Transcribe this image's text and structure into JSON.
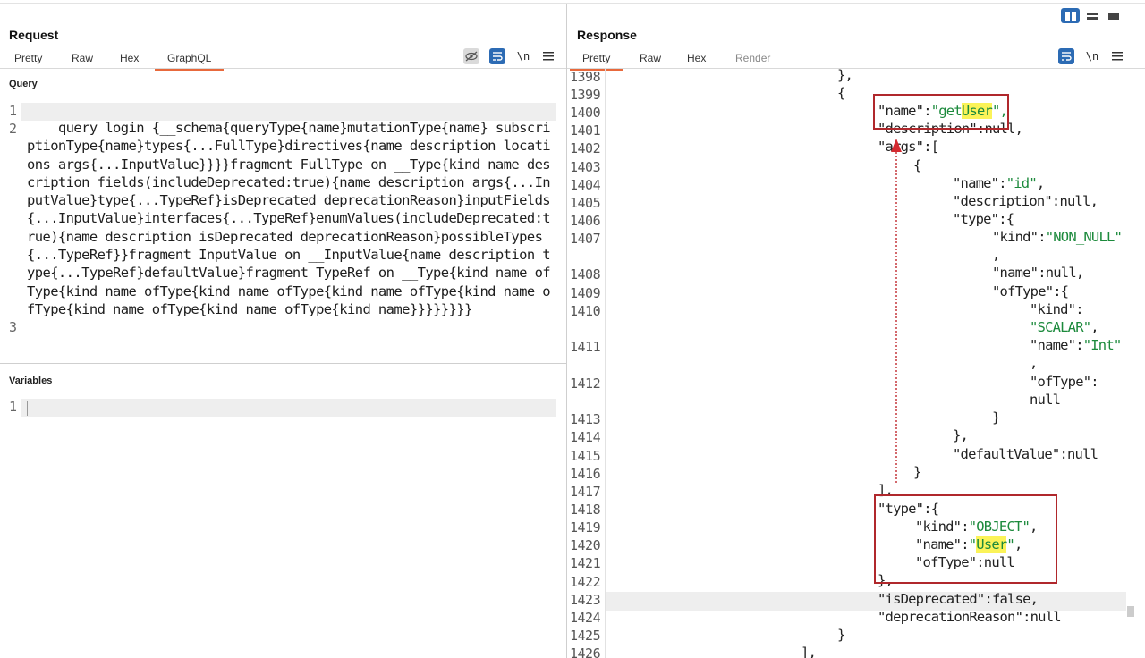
{
  "layout_modes": [
    {
      "icon": "split-vertical-icon",
      "active": true
    },
    {
      "icon": "split-horizontal-icon",
      "active": false
    },
    {
      "icon": "single-pane-icon",
      "active": false
    }
  ],
  "request": {
    "title": "Request",
    "tabs": [
      "Pretty",
      "Raw",
      "Hex",
      "GraphQL"
    ],
    "active_tab": "GraphQL",
    "toolbar_icons": [
      "hide-icon",
      "wrap-lines-icon",
      "newline-icon",
      "menu-icon"
    ],
    "newline_label": "\\n",
    "query_label": "Query",
    "query_line_numbers": [
      "1",
      "2",
      "3"
    ],
    "query_text": "    query login {__schema{queryType{name}mutationType{name} subscriptionType{name}types{...FullType}directives{name description locations args{...InputValue}}}}fragment FullType on __Type{kind name description fields(includeDeprecated:true){name description args{...InputValue}type{...TypeRef}isDeprecated deprecationReason}inputFields{...InputValue}interfaces{...TypeRef}enumValues(includeDeprecated:true){name description isDeprecated deprecationReason}possibleTypes{...TypeRef}}fragment InputValue on __InputValue{name description type{...TypeRef}defaultValue}fragment TypeRef on __Type{kind name ofType{kind name ofType{kind name ofType{kind name ofType{kind name ofType{kind name ofType{kind name ofType{kind name}}}}}}}}",
    "variables_label": "Variables",
    "variables_line_numbers": [
      "1"
    ]
  },
  "response": {
    "title": "Response",
    "tabs": [
      "Pretty",
      "Raw",
      "Hex",
      "Render"
    ],
    "active_tab": "Pretty",
    "toolbar_icons": [
      "wrap-lines-icon",
      "newline-icon",
      "menu-icon"
    ],
    "newline_label": "\\n",
    "line_numbers": [
      "1398",
      "1399",
      "1400",
      "1401",
      "1402",
      "1403",
      "1404",
      "1405",
      "1406",
      "1407",
      "1408",
      "1409",
      "1410",
      "1411",
      "1412",
      "1413",
      "1414",
      "1415",
      "1416",
      "1417",
      "1418",
      "1419",
      "1420",
      "1421",
      "1422",
      "1423",
      "1424",
      "1425",
      "1426"
    ],
    "lines": [
      [
        "},"
      ],
      [
        "{"
      ],
      [
        "\"name\":",
        "\"get",
        "User",
        "\","
      ],
      [
        "\"description\":null,"
      ],
      [
        "\"args\":["
      ],
      [
        "{"
      ],
      [
        "\"name\":",
        "\"id\"",
        ","
      ],
      [
        "\"description\":null,"
      ],
      [
        "\"type\":{"
      ],
      [
        "\"kind\":",
        "\"NON_NULL\""
      ],
      [
        ","
      ],
      [
        "\"name\":null,"
      ],
      [
        "\"ofType\":{"
      ],
      [
        "\"kind\":"
      ],
      [
        "\"SCALAR\"",
        ","
      ],
      [
        "\"name\":",
        "\"Int\""
      ],
      [
        ","
      ],
      [
        "\"ofType\":"
      ],
      [
        "null"
      ],
      [
        "}"
      ],
      [
        "},"
      ],
      [
        "\"defaultValue\":null"
      ],
      [
        "}"
      ],
      [
        "],"
      ],
      [
        "\"type\":{"
      ],
      [
        "\"kind\":",
        "\"OBJECT\"",
        ","
      ],
      [
        "\"name\":",
        "\"",
        "User",
        "\"",
        ","
      ],
      [
        "\"ofType\":null"
      ],
      [
        "},"
      ],
      [
        "\"isDeprecated\":false,"
      ],
      [
        "\"deprecationReason\":null"
      ],
      [
        "}"
      ],
      [
        "],"
      ]
    ]
  }
}
